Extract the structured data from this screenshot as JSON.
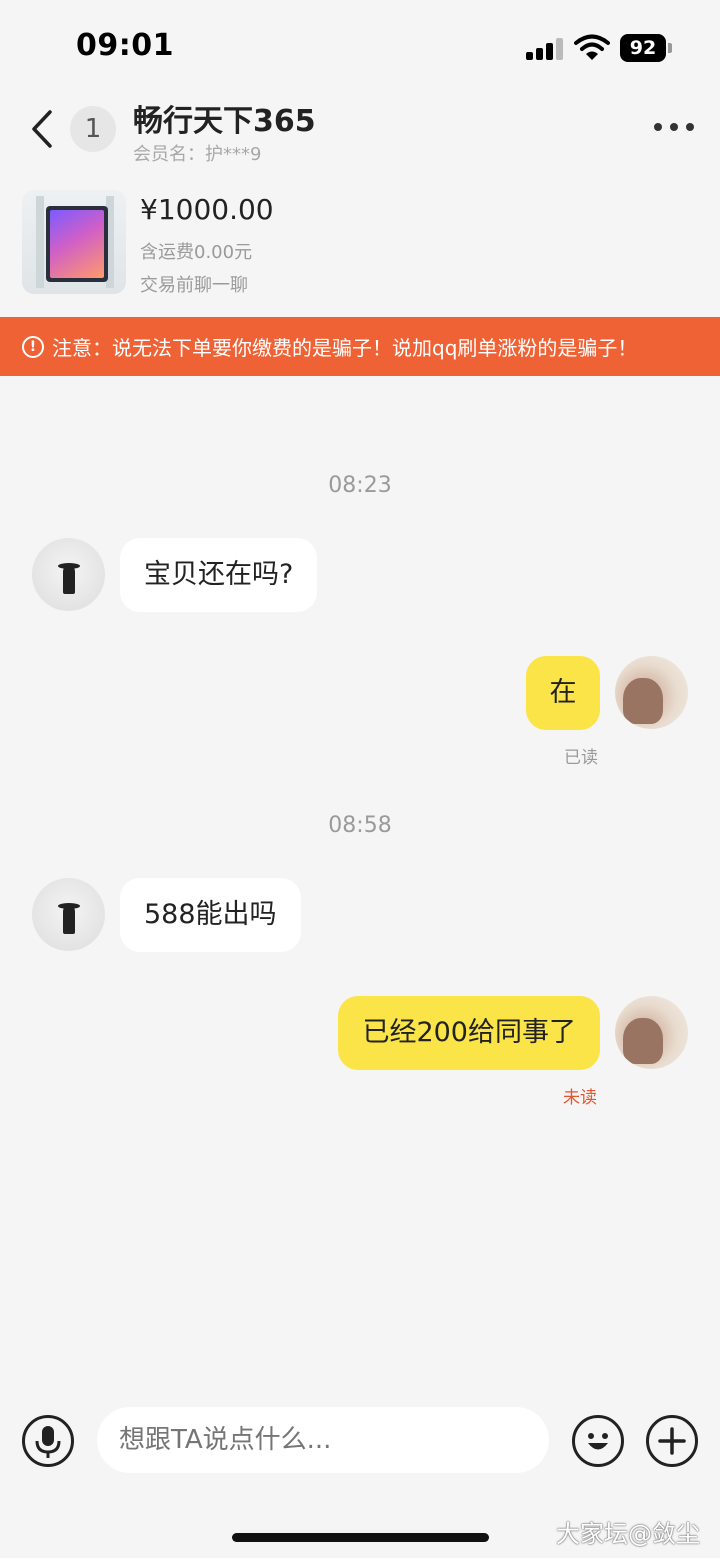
{
  "status_bar": {
    "time": "09:01",
    "battery": "92",
    "icons": [
      "signal-icon",
      "wifi-icon",
      "battery-icon"
    ]
  },
  "header": {
    "unread_count": "1",
    "title": "畅行天下365",
    "member_name": "会员名：护***9",
    "icons": [
      "chevron-left-icon",
      "more-dots-icon"
    ]
  },
  "product": {
    "price": "¥1000.00",
    "shipping": "含运费0.00元",
    "chat_hint": "交易前聊一聊"
  },
  "warning": {
    "text": "注意：说无法下单要你缴费的是骗子！说加qq刷单涨粉的是骗子！",
    "icon": "alert-circle-icon",
    "color": "#ef6236"
  },
  "messages": [
    {
      "type": "timestamp",
      "text": "08:23"
    },
    {
      "type": "incoming",
      "text": "宝贝还在吗?"
    },
    {
      "type": "outgoing",
      "text": "在",
      "status": "已读"
    },
    {
      "type": "timestamp",
      "text": "08:58"
    },
    {
      "type": "incoming",
      "text": "588能出吗"
    },
    {
      "type": "outgoing",
      "text": "已经200给同事了",
      "status": "未读"
    }
  ],
  "input_bar": {
    "placeholder": "想跟TA说点什么...",
    "icons": [
      "microphone-icon",
      "emoji-icon",
      "plus-icon"
    ]
  },
  "watermark": "大家坛@敛尘",
  "colors": {
    "outgoing_bubble": "#fbe447",
    "unread_status": "#e8542b"
  }
}
